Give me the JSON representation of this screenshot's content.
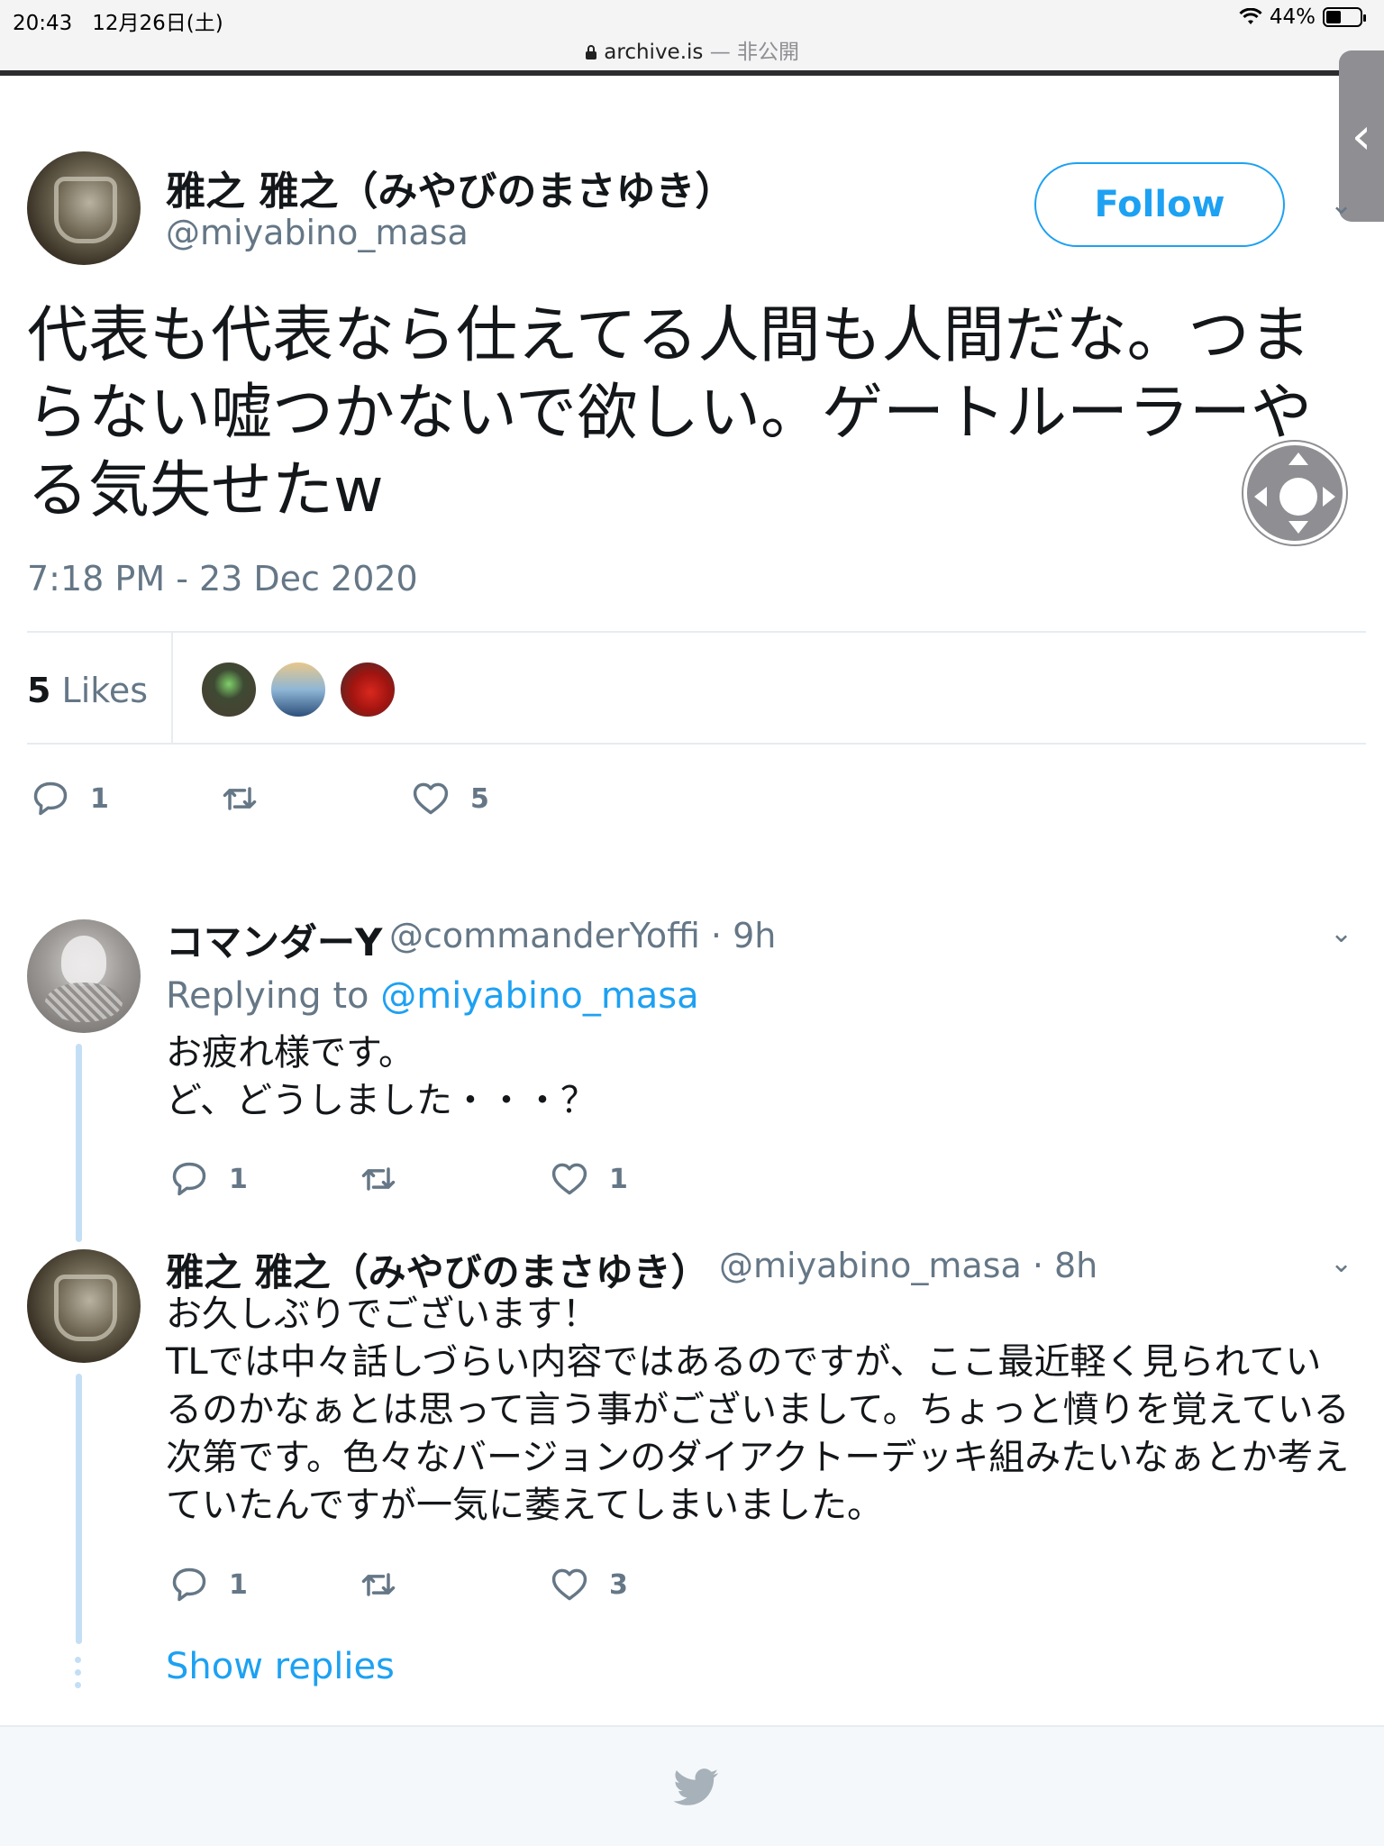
{
  "status_bar": {
    "time": "20:43",
    "date": "12月26日(土)",
    "wifi_icon": "wifi-icon",
    "battery_percent": "44%",
    "battery_level": 0.44
  },
  "url_bar": {
    "domain": "archive.is",
    "suffix": "— 非公開"
  },
  "main_tweet": {
    "author_name": "雅之 雅之（みやびのまさゆき）",
    "author_handle": "@miyabino_masa",
    "follow_label": "Follow",
    "text": "代表も代表なら仕えてる人間も人間だな。つまらない嘘つかないで欲しい。ゲートルーラーやる気失せたw",
    "timestamp": "7:18 PM - 23 Dec 2020",
    "likes_count": "5",
    "likes_label": "Likes",
    "reply_count": "1",
    "like_count": "5"
  },
  "replies": [
    {
      "author_name": "コマンダーY",
      "author_handle": "@commanderYoffi",
      "time": "· 9h",
      "replying_prefix": "Replying to",
      "replying_to": "@miyabino_masa",
      "line1": "お疲れ様です。",
      "line2": "ど、どうしました・・・？",
      "reply_count": "1",
      "like_count": "1"
    },
    {
      "author_name": "雅之 雅之（みやびのまさゆき）",
      "author_handle": "@miyabino_masa",
      "time": "· 8h",
      "line1": "お久しぶりでございます！",
      "line2": "TLでは中々話しづらい内容ではあるのですが、ここ最近軽く見られているのかなぁとは思って言う事がございまして。ちょっと憤りを覚えている次第です。色々なバージョンのダイアクトーデッキ組みたいなぁとか考えていたんですが一気に萎えてしまいました。",
      "reply_count": "1",
      "like_count": "3"
    }
  ],
  "show_replies_label": "Show replies",
  "colors": {
    "accent": "#1da1f2",
    "muted": "#657786",
    "text": "#14171a",
    "divider": "#e6ecf0",
    "thread": "#c4dff5"
  }
}
